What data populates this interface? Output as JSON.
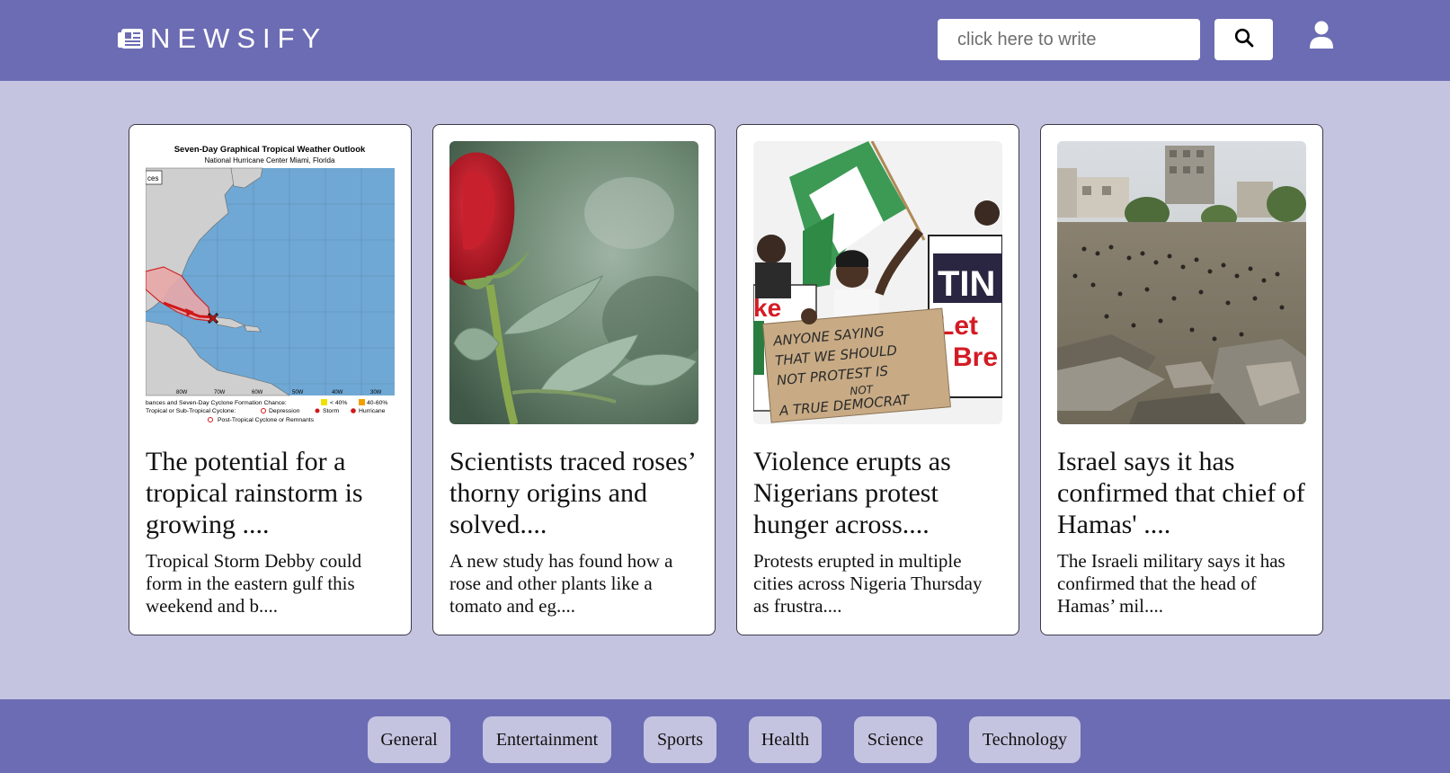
{
  "header": {
    "brand": "NEWSIFY",
    "logo_icon": "newspaper-icon",
    "search_placeholder": "click here to write",
    "search_icon": "search-icon",
    "user_icon": "user-icon",
    "colors": {
      "bar": "#6c6cb4",
      "page": "#c4c4e1"
    }
  },
  "articles": [
    {
      "title": "The potential for a tropical rainstorm is growing ....",
      "description": "Tropical Storm Debby could form in the eastern gulf this weekend and b....",
      "image": {
        "title": "Seven-Day Graphical Tropical Weather Outlook",
        "subtitle": "National Hurricane Center  Miami, Florida",
        "corner_tag": "ces",
        "lon_labels": [
          "80W",
          "70W",
          "60W",
          "50W",
          "40W",
          "30W"
        ],
        "legend_line1": "bances and Seven-Day Cyclone Formation Chance:",
        "legend_low": "< 40%",
        "legend_high": "40-60%",
        "legend_line2": "Tropical or Sub-Tropical Cyclone:",
        "legend_depression": "Depression",
        "legend_storm": "Storm",
        "legend_hurricane": "Hurricane",
        "legend_line3": "Post-Tropical Cyclone or Remnants"
      }
    },
    {
      "title": "Scientists traced roses’ thorny origins and solved....",
      "description": "A new study has found how a rose and other plants like a tomato and eg....",
      "image": {}
    },
    {
      "title": "Violence erupts as Nigerians protest hunger across....",
      "description": "Protests erupted in multiple cities across Nigeria Thursday as frustra....",
      "image": {
        "sign_text": [
          "ANYONE SAYING",
          "THAT WE SHOULD",
          "NOT PROTEST IS",
          "NOT",
          "A TRUE DEMOCRAT"
        ],
        "banner_text": [
          "TIN",
          "Let",
          "Bre"
        ],
        "left_banner": "ke"
      }
    },
    {
      "title": "Israel says it has confirmed that chief of Hamas' ....",
      "description": "The Israeli military says it has confirmed that the head of Hamas’ mil....",
      "image": {}
    }
  ],
  "categories": [
    "General",
    "Entertainment",
    "Sports",
    "Health",
    "Science",
    "Technology"
  ]
}
